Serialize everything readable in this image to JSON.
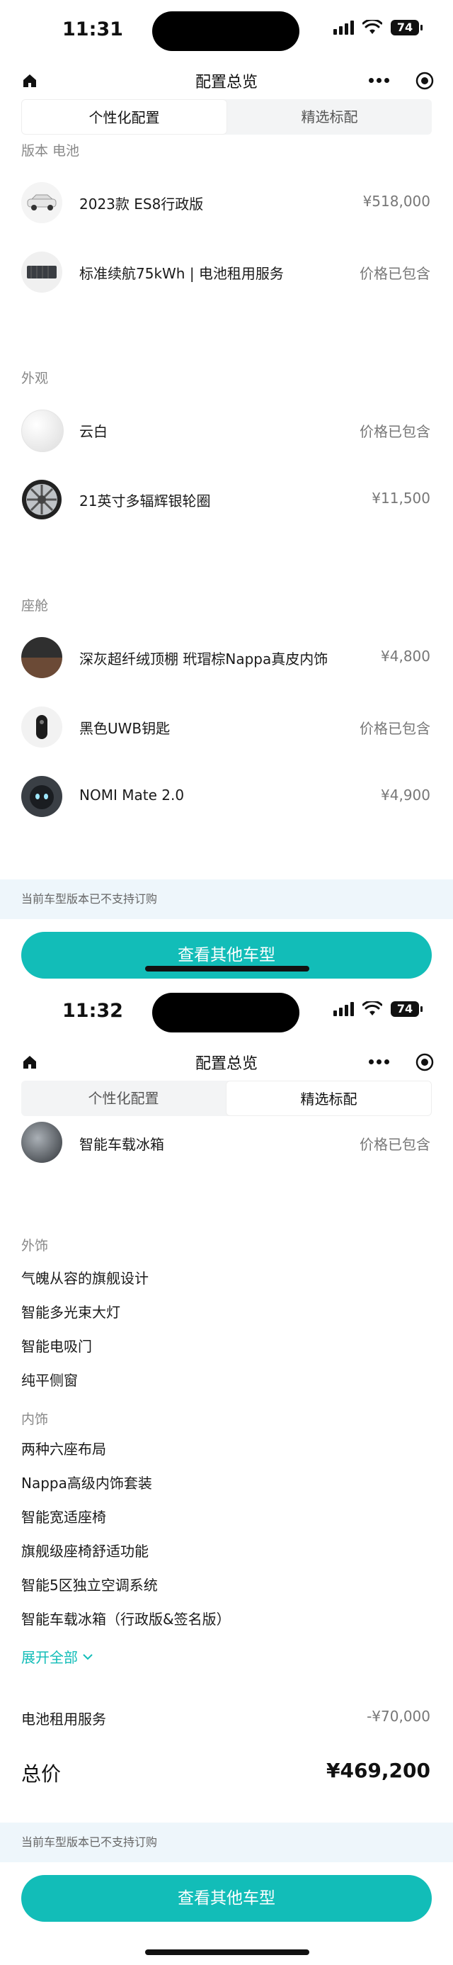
{
  "screen1": {
    "time": "11:31",
    "battery": "74",
    "nav_title": "配置总览",
    "tabs": [
      {
        "label": "个性化配置",
        "active": true
      },
      {
        "label": "精选标配",
        "active": false
      }
    ],
    "sections": {
      "version_battery": {
        "title": "版本 电池",
        "items": [
          {
            "name": "2023款 ES8行政版",
            "price": "¥518,000",
            "icon": "car-thumbnail"
          },
          {
            "name": "标准续航75kWh | 电池租用服务",
            "price": "价格已包含",
            "icon": "battery-pack-thumbnail"
          }
        ]
      },
      "exterior": {
        "title": "外观",
        "items": [
          {
            "name": "云白",
            "price": "价格已包含",
            "icon": "paint-swatch-white"
          },
          {
            "name": "21英寸多辐辉银轮圈",
            "price": "¥11,500",
            "icon": "wheel-rim"
          }
        ]
      },
      "cabin": {
        "title": "座舱",
        "items": [
          {
            "name": "深灰超纤绒顶棚 玳瑁棕Nappa真皮内饰",
            "price": "¥4,800",
            "icon": "interior-swatch"
          },
          {
            "name": "黑色UWB钥匙",
            "price": "价格已包含",
            "icon": "key-fob"
          },
          {
            "name": "NOMI Mate 2.0",
            "price": "¥4,900",
            "icon": "nomi-robot"
          }
        ]
      }
    },
    "notice": "当前车型版本已不支持订购",
    "cta": "查看其他车型"
  },
  "screen2": {
    "time": "11:32",
    "battery": "74",
    "nav_title": "配置总览",
    "tabs": [
      {
        "label": "个性化配置",
        "active": false
      },
      {
        "label": "精选标配",
        "active": true
      }
    ],
    "fridge_item": {
      "name": "智能车载冰箱",
      "price": "价格已包含",
      "icon": "fridge-thumbnail"
    },
    "exterior_title": "外饰",
    "exterior_features": [
      "气魄从容的旗舰设计",
      "智能多光束大灯",
      "智能电吸门",
      "纯平侧窗"
    ],
    "interior_title": "内饰",
    "interior_features": [
      "两种六座布局",
      "Nappa高级内饰套装",
      "智能宽适座椅",
      "旗舰级座椅舒适功能",
      "智能5区独立空调系统",
      "智能车载冰箱（行政版&签名版）"
    ],
    "expand_label": "展开全部",
    "battery_rent": {
      "label": "电池租用服务",
      "value": "-¥70,000"
    },
    "total": {
      "label": "总价",
      "value": "¥469,200"
    },
    "notice": "当前车型版本已不支持订购",
    "cta": "查看其他车型"
  },
  "colors": {
    "accent": "#12bdb8",
    "notice_bg": "#eef6fb",
    "tab_bg": "#f3f4f5"
  }
}
